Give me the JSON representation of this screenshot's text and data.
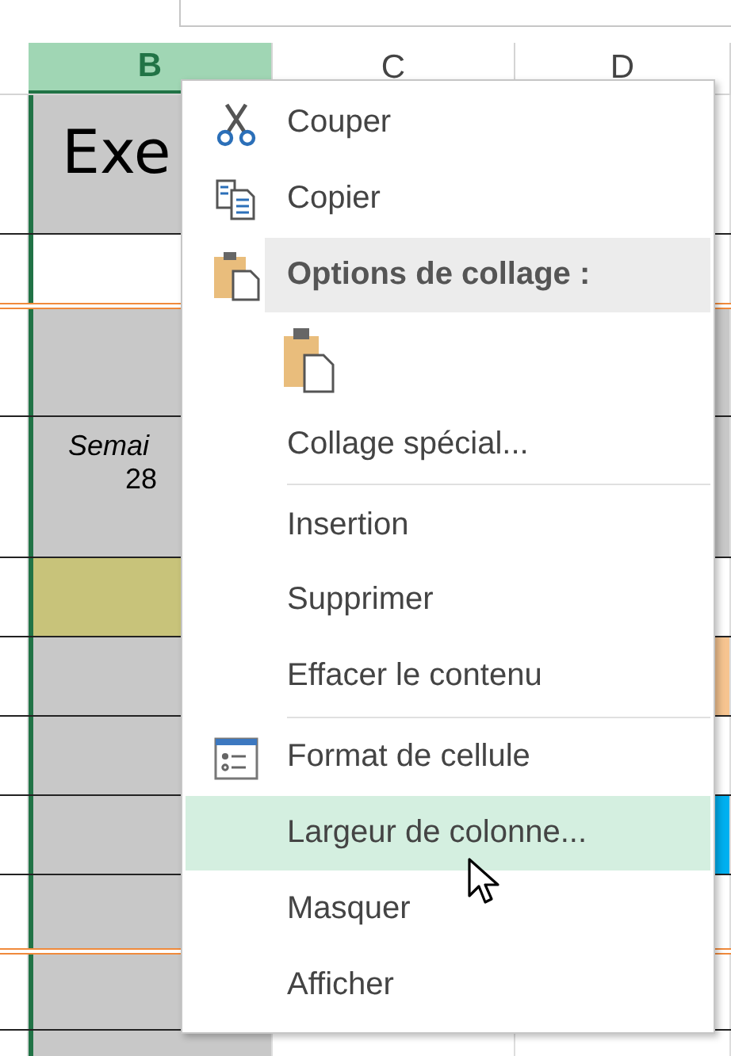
{
  "columns": [
    {
      "label": "B",
      "selected": true
    },
    {
      "label": "C",
      "selected": false
    },
    {
      "label": "D",
      "selected": false
    }
  ],
  "rows": [
    {
      "kind": "title",
      "text": "Exe",
      "cells": [
        {
          "color": "#c8c8c8"
        },
        {
          "color": "#ffffff"
        }
      ]
    },
    {
      "kind": "plain",
      "cells": [
        {
          "color": "#ffffff"
        },
        {
          "color": "#ffffff"
        }
      ]
    },
    {
      "kind": "plain",
      "cells": [
        {
          "color": "#c8c8c8"
        },
        {
          "color": "#c8c8c8"
        }
      ]
    },
    {
      "kind": "week",
      "lines": [
        "Semai",
        "28"
      ],
      "cells": [
        {
          "color": "#c8c8c8"
        },
        {
          "color": "#c8c8c8"
        }
      ]
    },
    {
      "kind": "plain",
      "cells": [
        {
          "color": "#c8c37a"
        },
        {
          "color": "#ffffff"
        }
      ]
    },
    {
      "kind": "plain",
      "cells": [
        {
          "color": "#c8c8c8"
        },
        {
          "color": "#f6c490"
        }
      ]
    },
    {
      "kind": "plain",
      "cells": [
        {
          "color": "#c8c8c8"
        },
        {
          "color": "#ffffff"
        }
      ]
    },
    {
      "kind": "plain",
      "cells": [
        {
          "color": "#c8c8c8"
        },
        {
          "color": "#00b0f0"
        }
      ]
    },
    {
      "kind": "plain",
      "cells": [
        {
          "color": "#c8c8c8"
        },
        {
          "color": "#ffffff"
        }
      ]
    },
    {
      "kind": "plain",
      "cells": [
        {
          "color": "#c8c8c8"
        },
        {
          "color": "#ffffff"
        }
      ]
    }
  ],
  "context_menu": {
    "items": [
      {
        "kind": "command",
        "label": "Couper",
        "selected": false
      },
      {
        "kind": "command",
        "label": "Copier",
        "selected": false
      },
      {
        "kind": "header",
        "label": "Options de collage :"
      },
      {
        "kind": "paste-options"
      },
      {
        "kind": "command",
        "label": "Collage spécial...",
        "selected": false
      },
      {
        "kind": "separator"
      },
      {
        "kind": "command",
        "label": "Insertion",
        "selected": false
      },
      {
        "kind": "command",
        "label": "Supprimer",
        "selected": false
      },
      {
        "kind": "command",
        "label": "Effacer le contenu",
        "selected": false
      },
      {
        "kind": "separator"
      },
      {
        "kind": "command",
        "label": "Format de cellule",
        "selected": false
      },
      {
        "kind": "command",
        "label": "Largeur de colonne...",
        "selected": true
      },
      {
        "kind": "command",
        "label": "Masquer",
        "selected": false
      },
      {
        "kind": "command",
        "label": "Afficher",
        "selected": false
      }
    ]
  }
}
